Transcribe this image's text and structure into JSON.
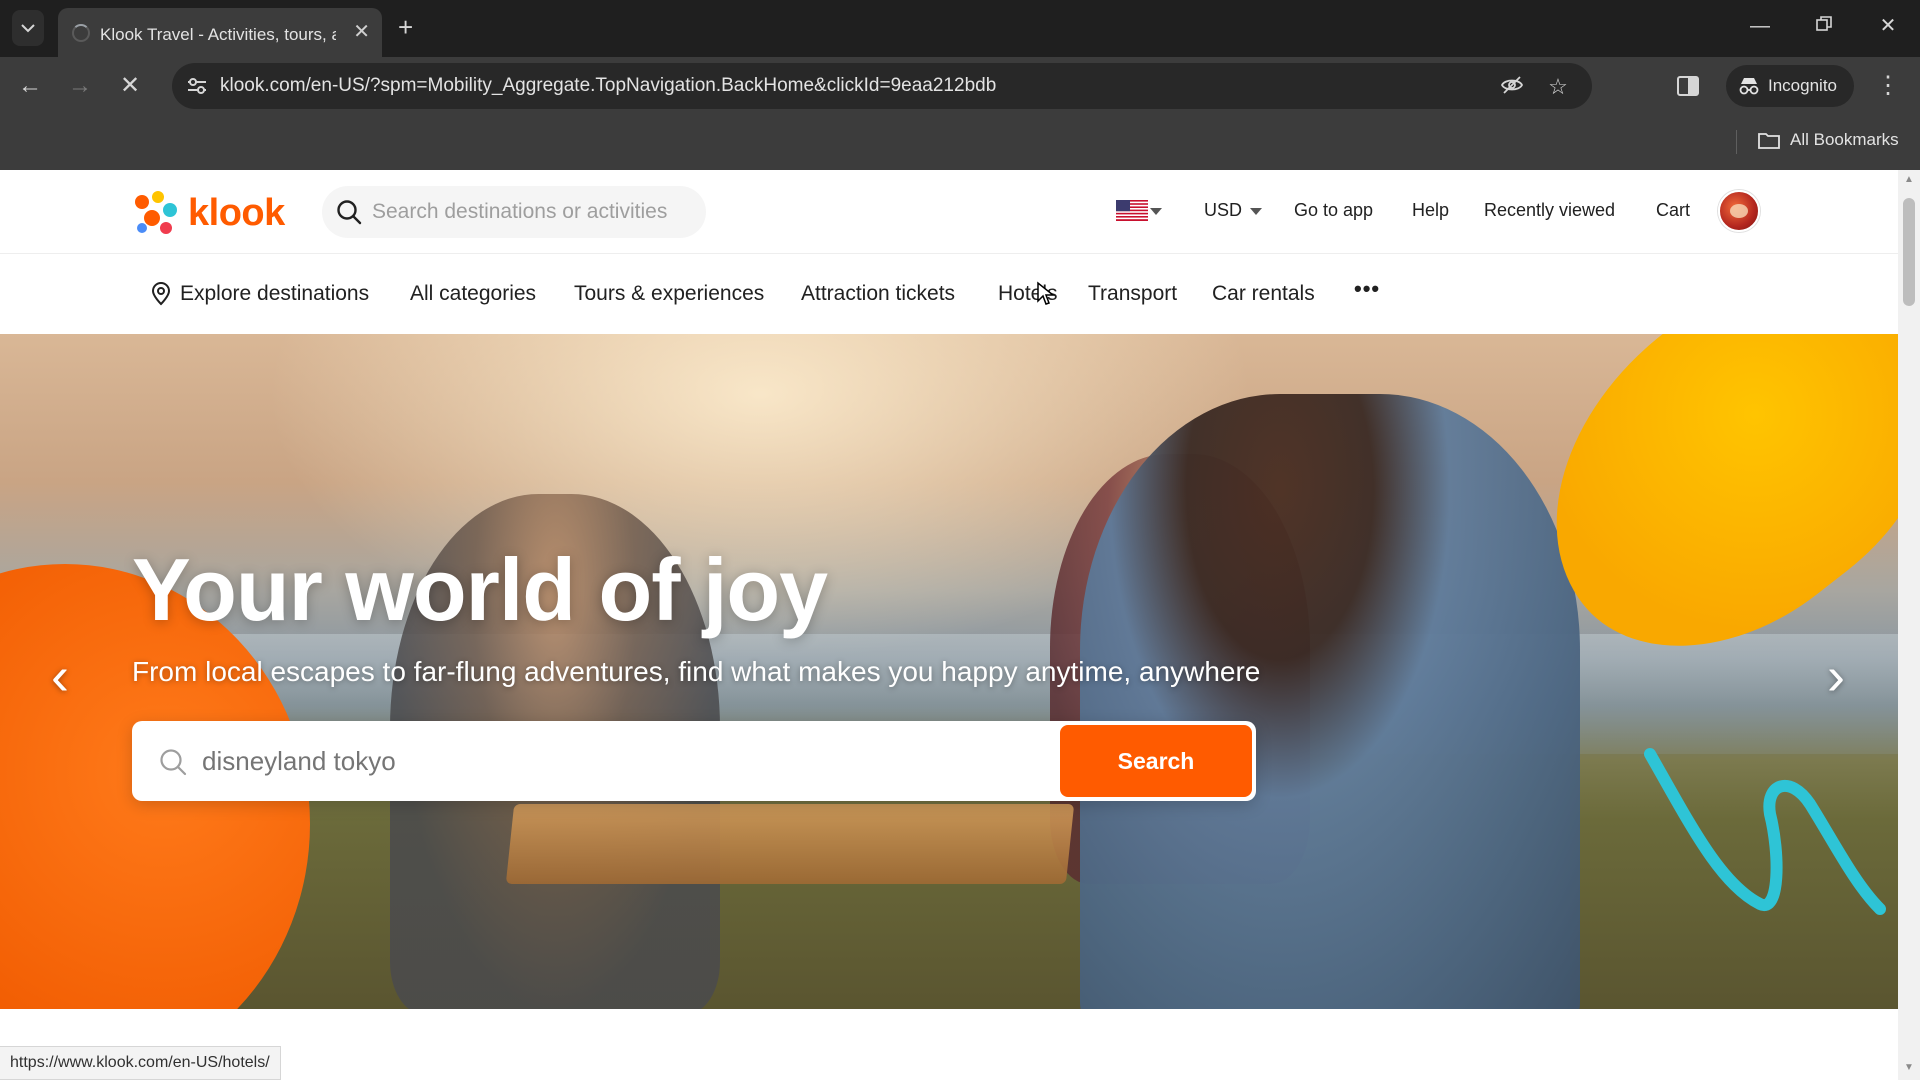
{
  "browser": {
    "tab_title": "Klook Travel - Activities, tours, a",
    "url": "klook.com/en-US/?spm=Mobility_Aggregate.TopNavigation.BackHome&clickId=9eaa212bdb",
    "incognito_label": "Incognito",
    "all_bookmarks_label": "All Bookmarks",
    "status_url": "https://www.klook.com/en-US/hotels/"
  },
  "header": {
    "logo_text": "klook",
    "search_placeholder": "Search destinations or activities",
    "currency": "USD",
    "links": [
      "Go to app",
      "Help",
      "Recently viewed",
      "Cart"
    ]
  },
  "nav": {
    "explore": "Explore destinations",
    "items": [
      "All categories",
      "Tours & experiences",
      "Attraction tickets",
      "Hotels",
      "Transport",
      "Car rentals"
    ],
    "more": "•••"
  },
  "hero": {
    "title": "Your world of joy",
    "subtitle": "From local escapes to far-flung adventures, find what makes you happy anytime, anywhere",
    "search_placeholder": "disneyland tokyo",
    "search_button": "Search"
  },
  "colors": {
    "brand_orange": "#ff5b00",
    "accent_yellow": "#ffc400",
    "accent_teal": "#2ec4d6"
  }
}
